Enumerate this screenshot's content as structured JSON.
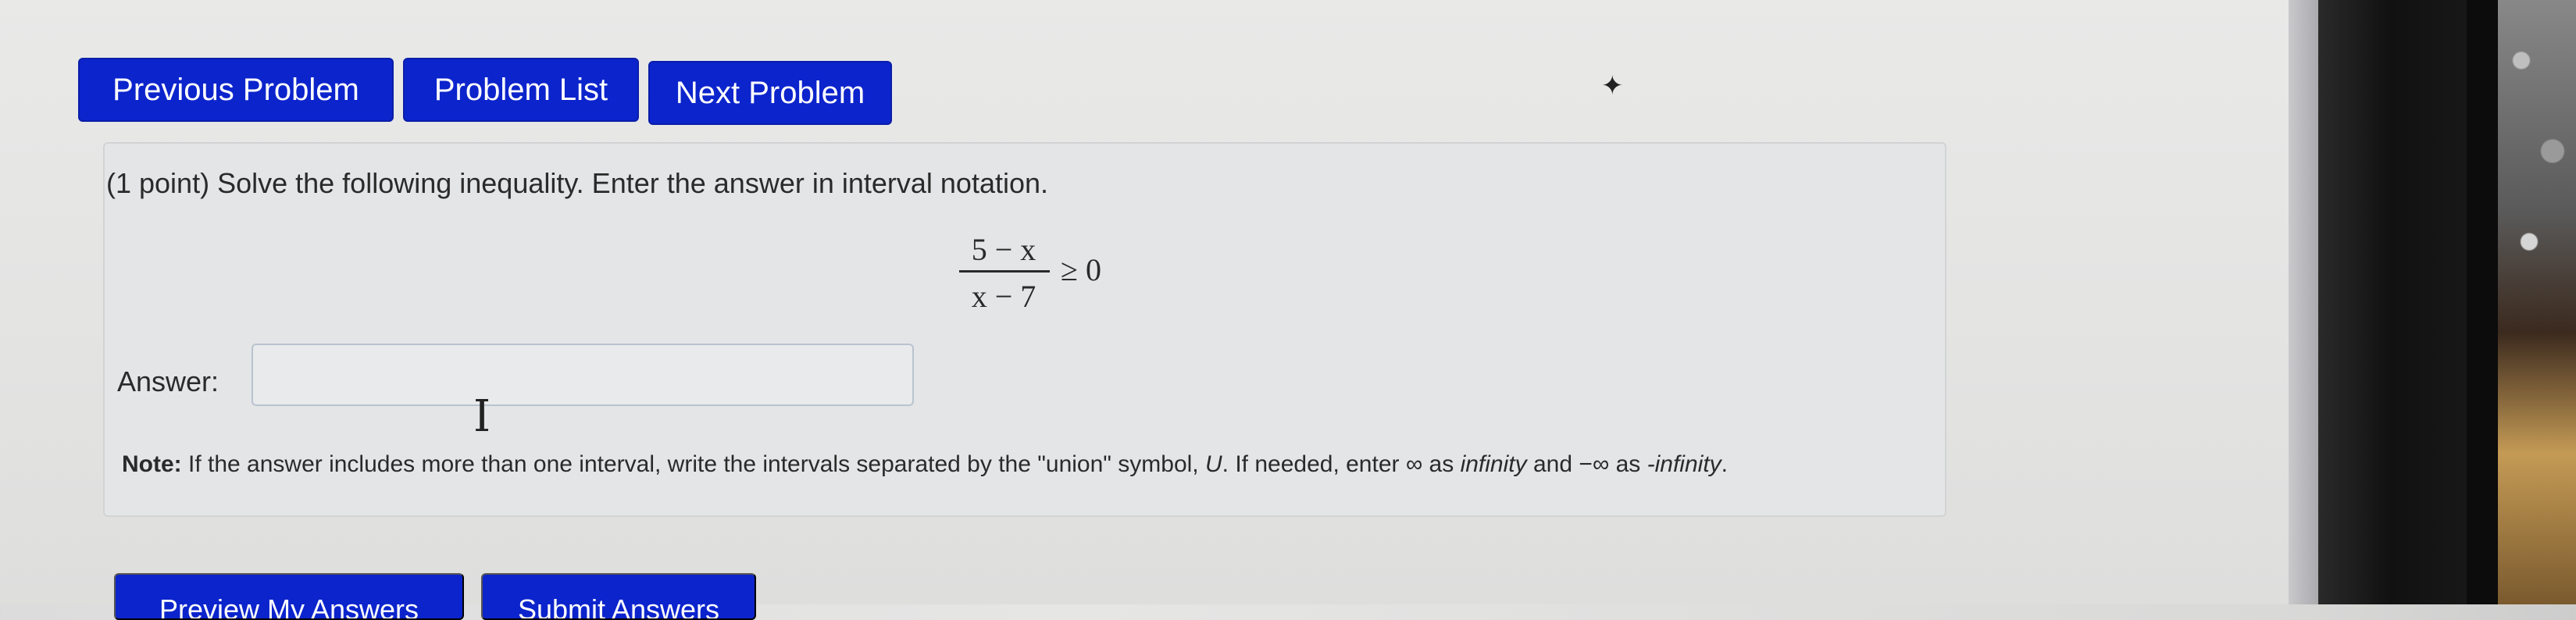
{
  "nav": {
    "previous_label": "Previous Problem",
    "list_label": "Problem List",
    "next_label": "Next Problem"
  },
  "problem": {
    "intro": "(1 point) Solve the following inequality. Enter the answer in interval notation.",
    "numerator": "5 − x",
    "denominator": "x − 7",
    "relation": "≥ 0"
  },
  "answer": {
    "label": "Answer:",
    "value": "",
    "placeholder": ""
  },
  "note": {
    "lead": "Note:",
    "text_part1": " If the answer includes more than one interval, write the intervals separated by the \"union\" symbol, ",
    "union_symbol": "U",
    "text_part2": ". If needed, enter ",
    "infinity_symbol": "∞",
    "text_part3": " as ",
    "infinity_word": "infinity",
    "text_part4": " and ",
    "neg_infinity_symbol": "−∞",
    "text_part5": " as ",
    "neg_infinity_word": "-infinity",
    "text_part6": "."
  },
  "bottom": {
    "preview_label": "Preview My Answers",
    "submit_label": "Submit Answers"
  },
  "colors": {
    "button_blue": "#0c24cc",
    "panel_bg": "#e4e5e7"
  },
  "icons": {
    "cursor": "text-cursor-icon",
    "stray_mark": "bird-doodle-icon"
  }
}
